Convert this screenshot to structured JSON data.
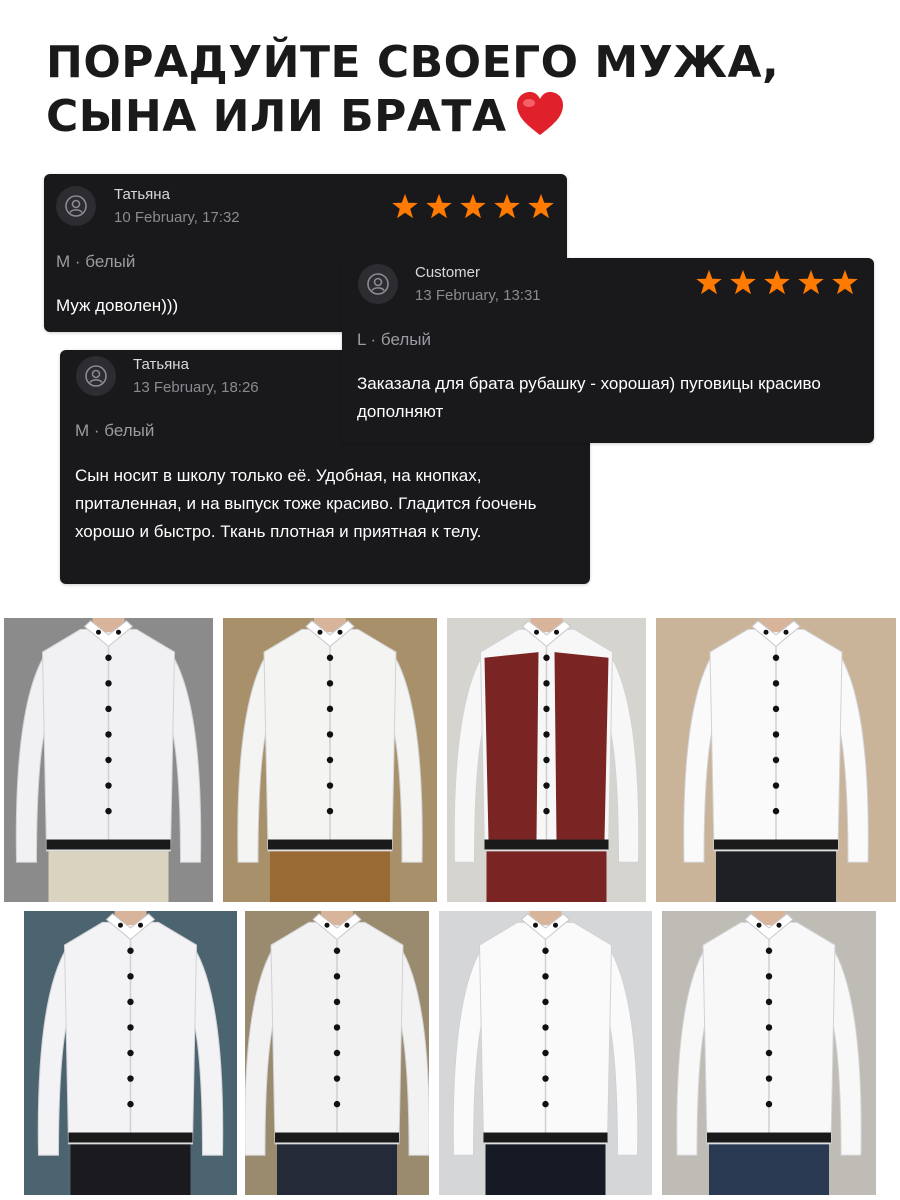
{
  "headline": {
    "line1": "ПОРАДУЙТЕ СВОЕГО МУЖА,",
    "line2": "СЫНА ИЛИ БРАТА",
    "emoji": "heart-emoji"
  },
  "reviews": [
    {
      "name": "Татьяна",
      "date": "10 February, 17:32",
      "variant": "M · белый",
      "text": "Муж доволен)))",
      "rating": 5
    },
    {
      "name": "Customer",
      "date": "13 February, 13:31",
      "variant": "L · белый",
      "text": "Заказала для брата рубашку - хорошая) пуговицы красиво дополняют",
      "rating": 5
    },
    {
      "name": "Татьяна",
      "date": "13 February, 18:26",
      "variant": "M · белый",
      "text": "Сын носит в школу только её. Удобная, на кнопках, приталенная, и на выпуск тоже красиво. Гладится ѓоочень хорошо и быстро. Ткань плотная и приятная к телу.",
      "rating": 5
    }
  ],
  "colors": {
    "card_bg": "#19191c",
    "star": "#ff7a00",
    "heart": "#e0202a"
  },
  "photos": [
    {
      "id": "photo-1",
      "bg": "#8c8b8c",
      "shirt": "#f1f1f3",
      "pants": "#d9d3bf",
      "vest": ""
    },
    {
      "id": "photo-2",
      "bg": "#a8916a",
      "shirt": "#f4f4f2",
      "pants": "#9a6a34",
      "vest": ""
    },
    {
      "id": "photo-3",
      "bg": "#d6d4cf",
      "shirt": "#f7f7f7",
      "pants": "#7a2424",
      "vest": "#7a2424"
    },
    {
      "id": "photo-4",
      "bg": "#c9b49a",
      "shirt": "#fafafa",
      "pants": "#1e2024",
      "vest": ""
    },
    {
      "id": "photo-5",
      "bg": "#4c6470",
      "shirt": "#f3f3f5",
      "pants": "#1b1b1f",
      "vest": ""
    },
    {
      "id": "photo-6",
      "bg": "#9a8a6e",
      "shirt": "#f2f2f2",
      "pants": "#252a38",
      "vest": ""
    },
    {
      "id": "photo-7",
      "bg": "#d4d6d8",
      "shirt": "#fafafa",
      "pants": "#161a24",
      "vest": ""
    },
    {
      "id": "photo-8",
      "bg": "#bfbcb6",
      "shirt": "#f8f8f8",
      "pants": "#2a3a52",
      "vest": ""
    }
  ]
}
